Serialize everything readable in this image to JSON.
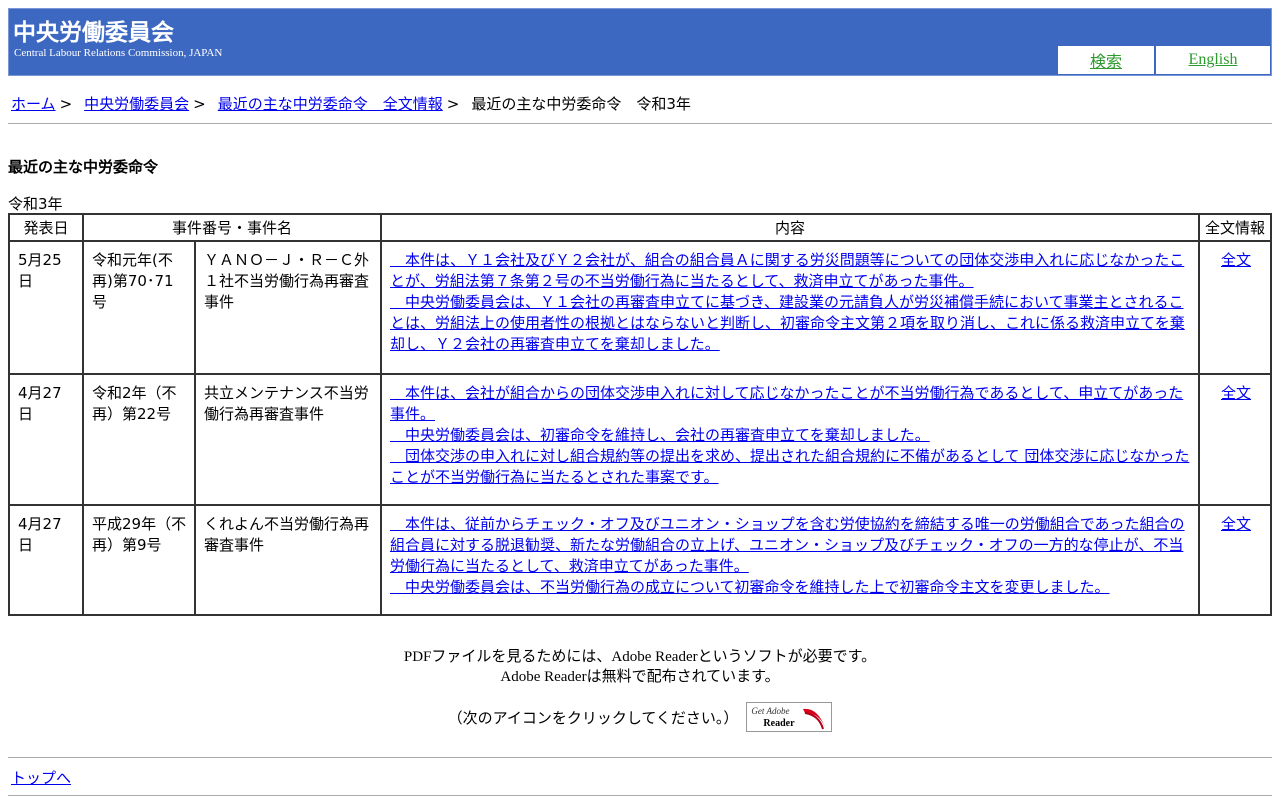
{
  "header": {
    "title": "中央労働委員会",
    "subtitle": "Central Labour Relations Commission, JAPAN",
    "nav": {
      "search": "検索",
      "english": "English"
    }
  },
  "breadcrumb": {
    "items": [
      "ホーム",
      "中央労働委員会",
      "最近の主な中労委命令　全文情報"
    ],
    "current": "最近の主な中労委命令　令和3年",
    "separator": ">"
  },
  "section_title": "最近の主な中労委命令",
  "year_caption": "令和3年",
  "table": {
    "headers": [
      "発表日",
      "事件番号・事件名",
      "内容",
      "全文情報"
    ],
    "rows": [
      {
        "date": "5月25日",
        "case_no": "令和元年(不再)第70･71号",
        "case_name": "ＹＡＮＯ－Ｊ・Ｒ－Ｃ外１社不当労働行為再審査事件",
        "content": [
          "　本件は、Ｙ１会社及びＹ２会社が、組合の組合員Ａに関する労災問題等についての団体交渉申入れに応じなかったことが、労組法第７条第２号の不当労働行為に当たるとして、救済申立てがあった事件。",
          "　中央労働委員会は、Ｙ１会社の再審査申立てに基づき、建設業の元請負人が労災補償手続において事業主とされることは、労組法上の使用者性の根拠とはならないと判断し、初審命令主文第２項を取り消し、これに係る救済申立てを棄却し、Ｙ２会社の再審査申立てを棄却しました。"
        ],
        "full_text": "全文"
      },
      {
        "date": "4月27日",
        "case_no": "令和2年（不再）第22号",
        "case_name": "共立メンテナンス不当労働行為再審査事件",
        "content": [
          "　本件は、会社が組合からの団体交渉申入れに対して応じなかったことが不当労働行為であるとして、申立てがあった事件。",
          "　中央労働委員会は、初審命令を維持し、会社の再審査申立てを棄却しました。",
          "　団体交渉の申入れに対し組合規約等の提出を求め、提出された組合規約に不備があるとして 団体交渉に応じなかったことが不当労働行為に当たるとされた事案です。"
        ],
        "full_text": "全文"
      },
      {
        "date": "4月27日",
        "case_no": "平成29年（不再）第9号",
        "case_name": "くれよん不当労働行為再審査事件",
        "content": [
          "　本件は、従前からチェック・オフ及びユニオン・ショップを含む労使協約を締結する唯一の労働組合であった組合の組合員に対する脱退勧奨、新たな労働組合の立上げ、ユニオン・ショップ及びチェック・オフの一方的な停止が、不当労働行為に当たるとして、救済申立てがあった事件。",
          "　中央労働委員会は、不当労働行為の成立について初審命令を維持した上で初審命令主文を変更しました。"
        ],
        "full_text": "全文"
      }
    ]
  },
  "footer": {
    "pdf_note_1": "PDFファイルを見るためには、Adobe Readerというソフトが必要です。",
    "pdf_note_2": "Adobe Readerは無料で配布されています。",
    "click_note": "（次のアイコンをクリックしてください。）",
    "adobe_badge_line1": "Get Adobe",
    "adobe_badge_line2": "Reader",
    "to_top": "トップへ"
  },
  "colors": {
    "header_bg": "#3d68c2",
    "link": "#0000ee",
    "nav_link": "#2e9a2e"
  }
}
